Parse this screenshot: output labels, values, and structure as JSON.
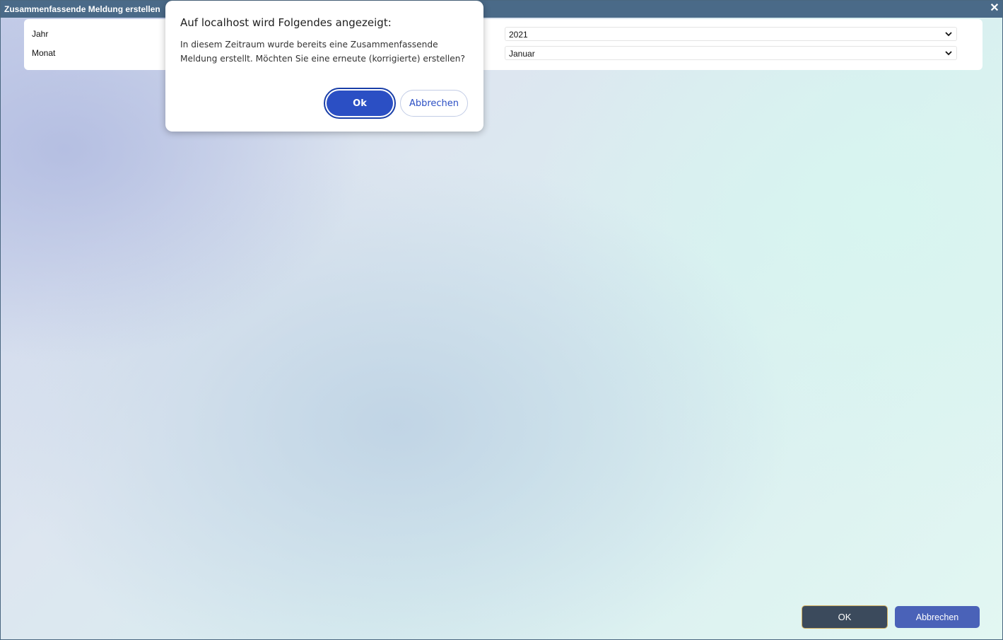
{
  "window": {
    "title": "Zusammenfassende Meldung erstellen",
    "close_glyph": "✕"
  },
  "form": {
    "year_label": "Jahr",
    "month_label": "Monat",
    "year_value": "2021",
    "month_value": "Januar"
  },
  "dialog": {
    "heading": "Auf localhost wird Folgendes angezeigt:",
    "message": "In diesem Zeitraum wurde bereits eine Zusammenfassende Meldung erstellt. Möchten Sie eine erneute (korrigierte) erstellen?",
    "ok_label": "Ok",
    "cancel_label": "Abbrechen"
  },
  "footer": {
    "ok_label": "OK",
    "cancel_label": "Abbrechen"
  },
  "colors": {
    "titlebar": "#4a6a88",
    "dialog_primary": "#2b4fc4",
    "footer_ok": "#3b4a5c",
    "footer_cancel": "#4a62b8"
  },
  "icons": {
    "close": "close-icon",
    "dropdown": "chevron-down-icon"
  }
}
